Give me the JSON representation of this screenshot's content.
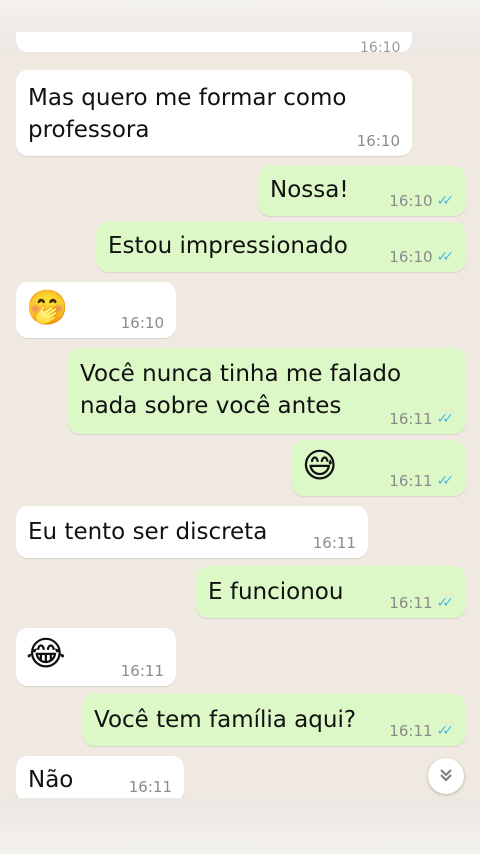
{
  "top_partial_time": "16:10",
  "messages": [
    {
      "text": "Mas quero me formar como professora",
      "time": "16:10"
    },
    {
      "text": "Nossa!",
      "time": "16:10"
    },
    {
      "text": "Estou impressionado",
      "time": "16:10"
    },
    {
      "text": "🤭",
      "time": "16:10"
    },
    {
      "text": "Você nunca tinha me falado nada sobre você antes",
      "time": "16:11"
    },
    {
      "text": "😅",
      "time": "16:11"
    },
    {
      "text": "Eu tento ser discreta",
      "time": "16:11"
    },
    {
      "text": "E funcionou",
      "time": "16:11"
    },
    {
      "text": "😂",
      "time": "16:11"
    },
    {
      "text": "Você tem família aqui?",
      "time": "16:11"
    },
    {
      "text": "Não",
      "time": "16:11"
    }
  ],
  "icons": {
    "read_receipt": "double-check-icon",
    "scroll_down": "chevron-double-down-icon"
  },
  "colors": {
    "incoming": "#ffffff",
    "outgoing": "#dcf8c6",
    "read_ticks": "#4fb6ec",
    "background": "#efe9e1"
  }
}
